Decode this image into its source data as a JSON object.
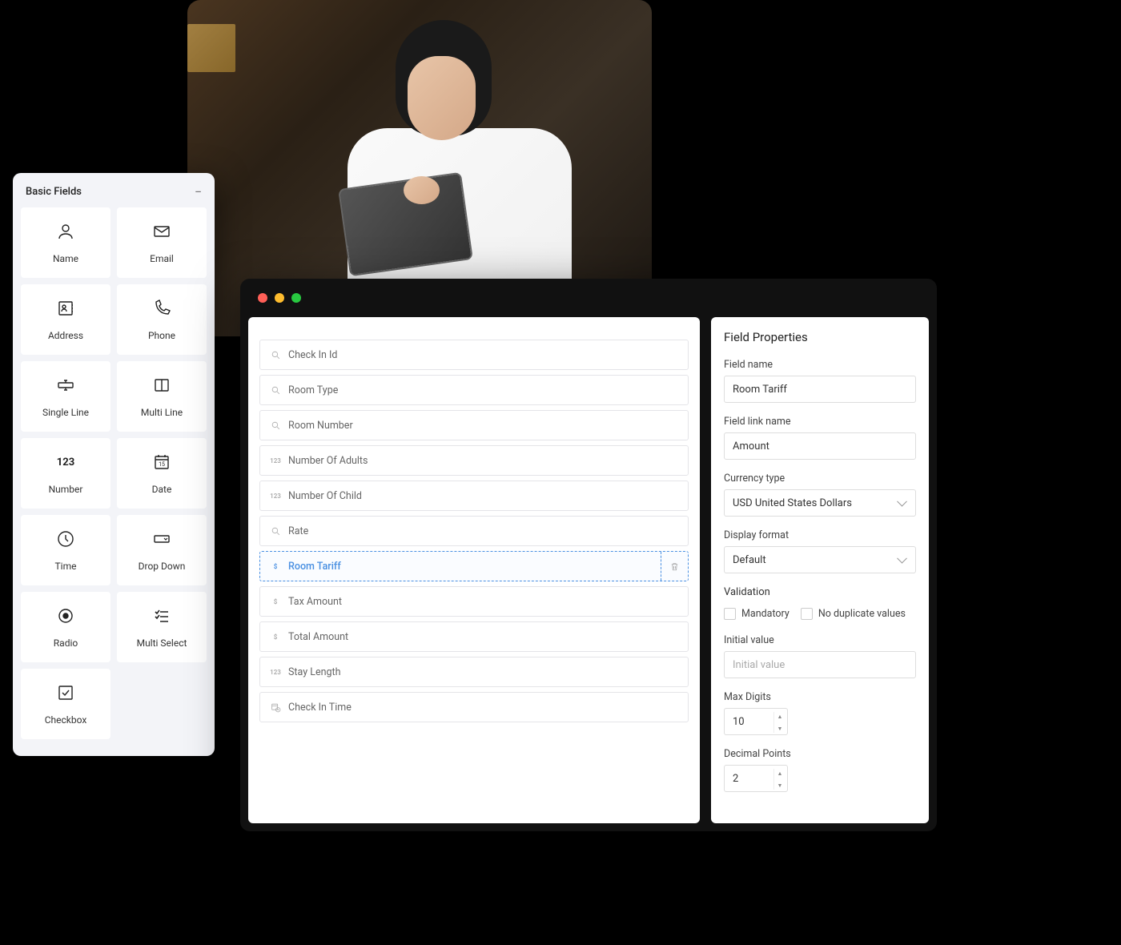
{
  "basic_fields": {
    "title": "Basic Fields",
    "tiles": [
      {
        "label": "Name",
        "icon": "user"
      },
      {
        "label": "Email",
        "icon": "mail"
      },
      {
        "label": "Address",
        "icon": "address"
      },
      {
        "label": "Phone",
        "icon": "phone"
      },
      {
        "label": "Single Line",
        "icon": "singleline"
      },
      {
        "label": "Multi Line",
        "icon": "multiline"
      },
      {
        "label": "Number",
        "icon": "123"
      },
      {
        "label": "Date",
        "icon": "date"
      },
      {
        "label": "Time",
        "icon": "time"
      },
      {
        "label": "Drop Down",
        "icon": "dropdown"
      },
      {
        "label": "Radio",
        "icon": "radio"
      },
      {
        "label": "Multi Select",
        "icon": "multiselect"
      },
      {
        "label": "Checkbox",
        "icon": "checkbox"
      }
    ]
  },
  "form": {
    "fields": [
      {
        "label": "Check In Id",
        "icon": "search",
        "selected": false
      },
      {
        "label": "Room Type",
        "icon": "search",
        "selected": false
      },
      {
        "label": "Room Number",
        "icon": "search",
        "selected": false
      },
      {
        "label": "Number Of Adults",
        "icon": "123",
        "selected": false
      },
      {
        "label": "Number Of Child",
        "icon": "123",
        "selected": false
      },
      {
        "label": "Rate",
        "icon": "search",
        "selected": false
      },
      {
        "label": "Room Tariff",
        "icon": "currency",
        "selected": true
      },
      {
        "label": "Tax Amount",
        "icon": "currency",
        "selected": false
      },
      {
        "label": "Total Amount",
        "icon": "currency",
        "selected": false
      },
      {
        "label": "Stay Length",
        "icon": "123",
        "selected": false
      },
      {
        "label": "Check In Time",
        "icon": "datetime",
        "selected": false
      }
    ]
  },
  "properties": {
    "title": "Field Properties",
    "field_name_label": "Field name",
    "field_name_value": "Room Tariff",
    "link_name_label": "Field link name",
    "link_name_value": "Amount",
    "currency_label": "Currency type",
    "currency_value": "USD United States Dollars",
    "display_label": "Display format",
    "display_value": "Default",
    "validation_label": "Validation",
    "mandatory_label": "Mandatory",
    "nodup_label": "No duplicate values",
    "initial_label": "Initial value",
    "initial_placeholder": "Initial value",
    "maxdigits_label": "Max Digits",
    "maxdigits_value": "10",
    "decimal_label": "Decimal Points",
    "decimal_value": "2"
  }
}
